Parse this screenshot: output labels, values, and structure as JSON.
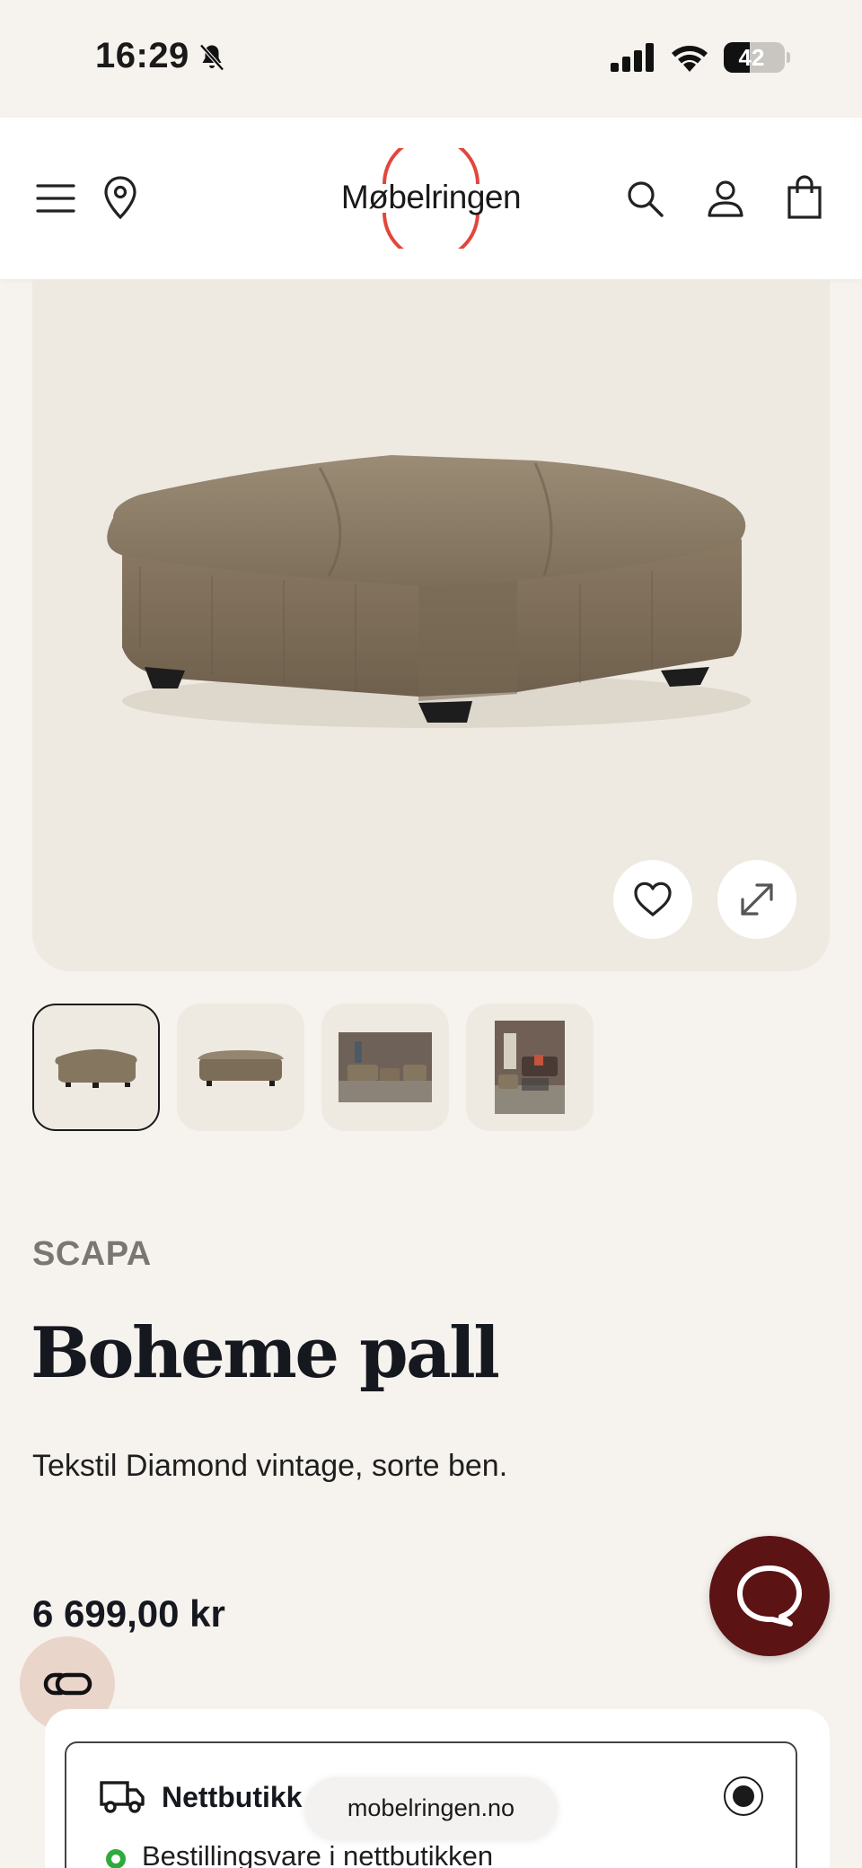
{
  "status_bar": {
    "time": "16:29",
    "battery": "42",
    "battery_level": 0.42
  },
  "header": {
    "logo_text": "Møbelringen",
    "logo_ring_color": "#e2463c"
  },
  "product": {
    "brand": "SCAPA",
    "title": "Boheme pall",
    "description": "Tekstil Diamond vintage, sorte ben.",
    "price": "6 699,00 kr",
    "thumbnails": [
      "thumbnail-1",
      "thumbnail-2",
      "thumbnail-3",
      "thumbnail-4"
    ],
    "selected_thumbnail": 1
  },
  "delivery": {
    "option_label": "Nettbutikk",
    "stock_status": "Bestillingsvare i nettbutikken",
    "selected": true
  },
  "browser": {
    "url": "mobelringen.no"
  },
  "colors": {
    "chat": "#5c1314",
    "accent": "#e2463c",
    "stock_green": "#2faa3c"
  }
}
